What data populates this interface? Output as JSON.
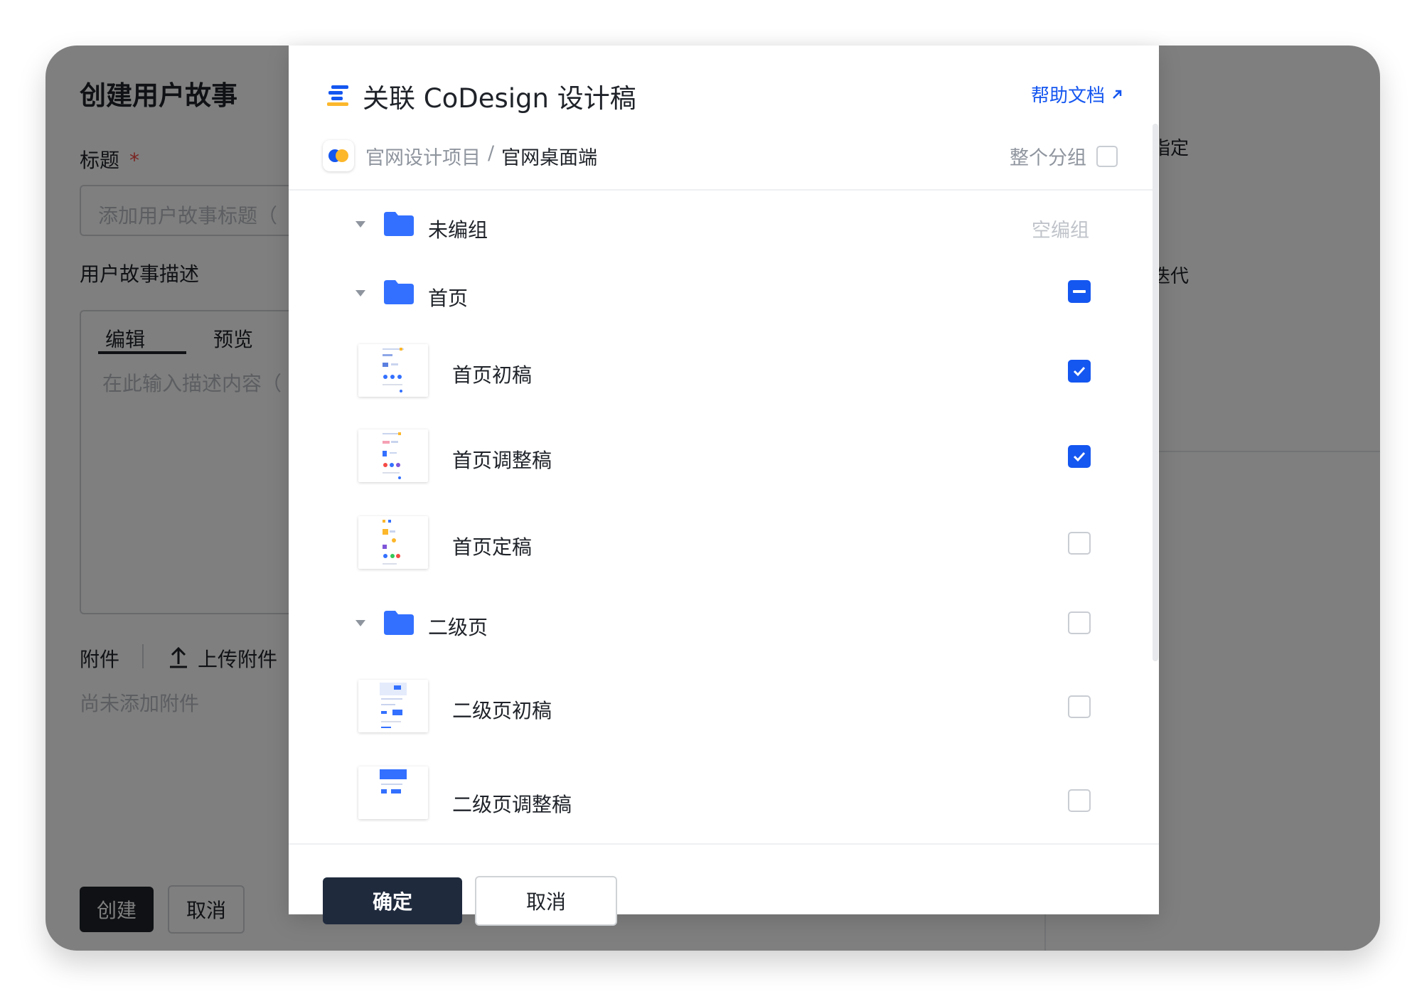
{
  "background": {
    "title": "创建用户故事",
    "title_label": "标题",
    "required_mark": "*",
    "title_placeholder": "添加用户故事标题（",
    "description_label": "用户故事描述",
    "tab_edit": "编辑",
    "tab_preview": "预览",
    "description_placeholder": "在此输入描述内容（",
    "attachments_label": "附件",
    "upload_label": "上传附件",
    "no_attachments": "尚未添加附件",
    "create_button": "创建",
    "cancel_button": "取消",
    "right_assign": "指定",
    "right_iteration": "迭代"
  },
  "modal": {
    "title": "关联 CoDesign 设计稿",
    "help_link": "帮助文档",
    "breadcrumb_project": "官网设计项目",
    "breadcrumb_separator": "/",
    "breadcrumb_current": "官网桌面端",
    "whole_group_label": "整个分组",
    "confirm_button": "确定",
    "cancel_button": "取消",
    "groups": [
      {
        "label": "未编组",
        "status": "空编组"
      },
      {
        "label": "首页",
        "state": "indeterminate"
      },
      {
        "label": "二级页",
        "state": "unchecked"
      }
    ],
    "files": [
      {
        "label": "首页初稿",
        "checked": true
      },
      {
        "label": "首页调整稿",
        "checked": true
      },
      {
        "label": "首页定稿",
        "checked": false
      },
      {
        "label": "二级页初稿",
        "checked": false
      },
      {
        "label": "二级页调整稿",
        "checked": false
      }
    ]
  },
  "colors": {
    "accent": "#1456f0",
    "folder": "#3370ff",
    "primary_button": "#1f2a3d"
  }
}
